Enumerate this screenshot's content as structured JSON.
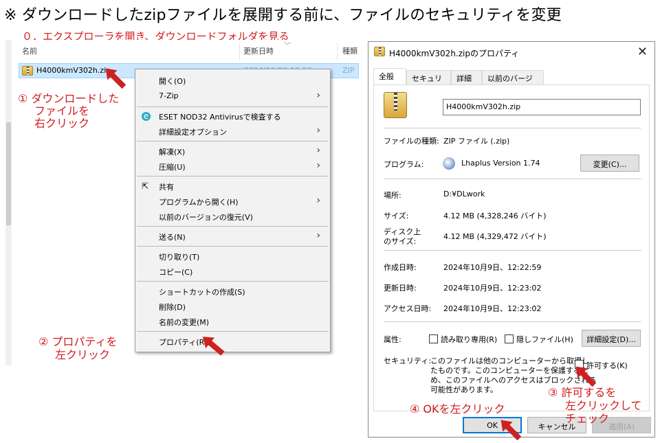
{
  "heading": "※ ダウンロードしたzipファイルを展開する前に、ファイルのセキュリティを変更",
  "steps": {
    "s0": "０．エクスプローラを開き、ダウンロードフォルダを見る",
    "s1": [
      "① ダウンロードした",
      "ファイルを",
      "右クリック"
    ],
    "s2": [
      "② プロパティを",
      "左クリック"
    ],
    "s3": [
      "③ 許可するを",
      "左クリックして",
      "チェック"
    ],
    "s4": "④ OKを左クリック"
  },
  "explorer": {
    "columns": [
      "名前",
      "更新日時",
      "種類"
    ],
    "file": {
      "name": "H4000kmV302h.zip",
      "date": "2024/10/09 12:23",
      "type": "ZIP"
    }
  },
  "menu": {
    "items": [
      {
        "label": "開く(O)"
      },
      {
        "label": "7-Zip",
        "submenu": true
      },
      {
        "label": "ESET NOD32 Antivirusで検査する",
        "icon": "eset-icon"
      },
      {
        "label": "詳細設定オプション",
        "submenu": true
      },
      {
        "label": "解凍(X)",
        "submenu": true
      },
      {
        "label": "圧縮(U)",
        "submenu": true
      },
      {
        "label": "共有",
        "icon": "share-icon"
      },
      {
        "label": "プログラムから開く(H)",
        "submenu": true
      },
      {
        "label": "以前のバージョンの復元(V)"
      },
      {
        "label": "送る(N)",
        "submenu": true
      },
      {
        "label": "切り取り(T)"
      },
      {
        "label": "コピー(C)"
      },
      {
        "label": "ショートカットの作成(S)"
      },
      {
        "label": "削除(D)"
      },
      {
        "label": "名前の変更(M)"
      },
      {
        "label": "プロパティ(R)"
      }
    ]
  },
  "dialog": {
    "title": "H4000kmV302h.zipのプロパティ",
    "tabs": [
      "全般",
      "セキュリティ",
      "詳細",
      "以前のバージョン"
    ],
    "filename": "H4000kmV302h.zip",
    "file_type_label": "ファイルの種類:",
    "file_type": "ZIP ファイル (.zip)",
    "program_label": "プログラム:",
    "program": "Lhaplus Version 1.74",
    "change_button": "変更(C)...",
    "location_label": "場所:",
    "location": "D:¥DLwork",
    "size_label": "サイズ:",
    "size": "4.12 MB (4,328,246 バイト)",
    "disk_size_label_1": "ディスク上",
    "disk_size_label_2": "のサイズ:",
    "disk_size": "4.12 MB (4,329,472 バイト)",
    "created_label": "作成日時:",
    "created": "2024年10月9日、12:22:59",
    "modified_label": "更新日時:",
    "modified": "2024年10月9日、12:23:02",
    "accessed_label": "アクセス日時:",
    "accessed": "2024年10月9日、12:23:02",
    "attributes_label": "属性:",
    "readonly_label": "読み取り専用(R)",
    "hidden_label": "隠しファイル(H)",
    "advanced_button": "詳細設定(D)...",
    "security_label": "セキュリティ:",
    "security_text": [
      "このファイルは他のコンピューターから取得し",
      "たものです。このコンピューターを保護するた",
      "め、このファイルへのアクセスはブロックされる",
      "可能性があります。"
    ],
    "allow_label": "許可する(K)",
    "ok_button": "OK",
    "cancel_button": "キャンセル",
    "apply_button": "適用(A)"
  }
}
